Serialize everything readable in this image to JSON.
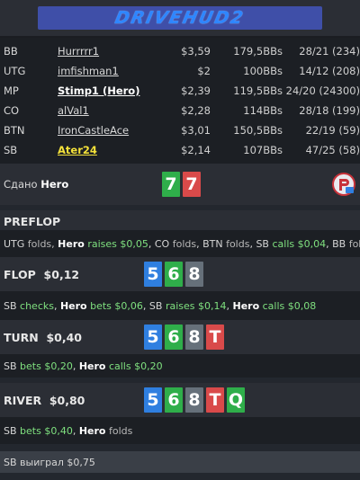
{
  "header": {
    "logo_text": "DRIVEHUD2"
  },
  "players": [
    {
      "position": "BB",
      "name": "Hurrrrr1",
      "stack": "$3,59",
      "bbs": "179,5BBs",
      "stats": "28/21 (234)"
    },
    {
      "position": "UTG",
      "name": "imfishman1",
      "stack": "$2",
      "bbs": "100BBs",
      "stats": "14/12 (208)"
    },
    {
      "position": "MP",
      "name": "Stimp1 (Hero)",
      "stack": "$2,39",
      "bbs": "119,5BBs",
      "stats": "24/20 (24300)"
    },
    {
      "position": "CO",
      "name": "alVal1",
      "stack": "$2,28",
      "bbs": "114BBs",
      "stats": "28/18 (199)"
    },
    {
      "position": "BTN",
      "name": "IronCastleAce",
      "stack": "$3,01",
      "bbs": "150,5BBs",
      "stats": "22/19 (59)"
    },
    {
      "position": "SB",
      "name": "Ater24",
      "stack": "$2,14",
      "bbs": "107BBs",
      "stats": "47/25 (58)"
    }
  ],
  "dealt": {
    "prefix": "Сдано",
    "hero": "Hero",
    "cards": [
      "7",
      "7"
    ]
  },
  "preflop": {
    "label": "PREFLOP",
    "a1": "UTG",
    "a2": " folds, ",
    "a3": "Hero",
    "a4": " raises $0,05",
    "a5": ", CO ",
    "a6": "folds",
    "a7": ", BTN ",
    "a8": "folds",
    "a9": ", SB ",
    "a10": "calls $0,04",
    "a11": ", BB ",
    "a12": "folds"
  },
  "flop": {
    "label": "FLOP  $0,12",
    "cards": [
      "5",
      "6",
      "8"
    ],
    "a1": "SB ",
    "a2": "checks",
    "a3": ", ",
    "a4": "Hero",
    "a5": " bets $0,06",
    "a6": ", SB ",
    "a7": "raises $0,14",
    "a8": ", ",
    "a9": "Hero",
    "a10": " calls $0,08"
  },
  "turn": {
    "label": "TURN  $0,40",
    "cards": [
      "5",
      "6",
      "8",
      "T"
    ],
    "a1": "SB ",
    "a2": "bets $0,20",
    "a3": ", ",
    "a4": "Hero",
    "a5": " calls $0,20"
  },
  "river": {
    "label": "RIVER  $0,80",
    "cards": [
      "5",
      "6",
      "8",
      "T",
      "Q"
    ],
    "a1": "SB ",
    "a2": "bets $0,40",
    "a3": ", ",
    "a4": "Hero",
    "a5": " folds"
  },
  "result": "SB выиграл $0,75",
  "colors": {
    "green": "#2fae4a",
    "red": "#d94a4a",
    "blue": "#2f7fe0",
    "gray": "#66707a",
    "winner": "#f5e23a"
  }
}
